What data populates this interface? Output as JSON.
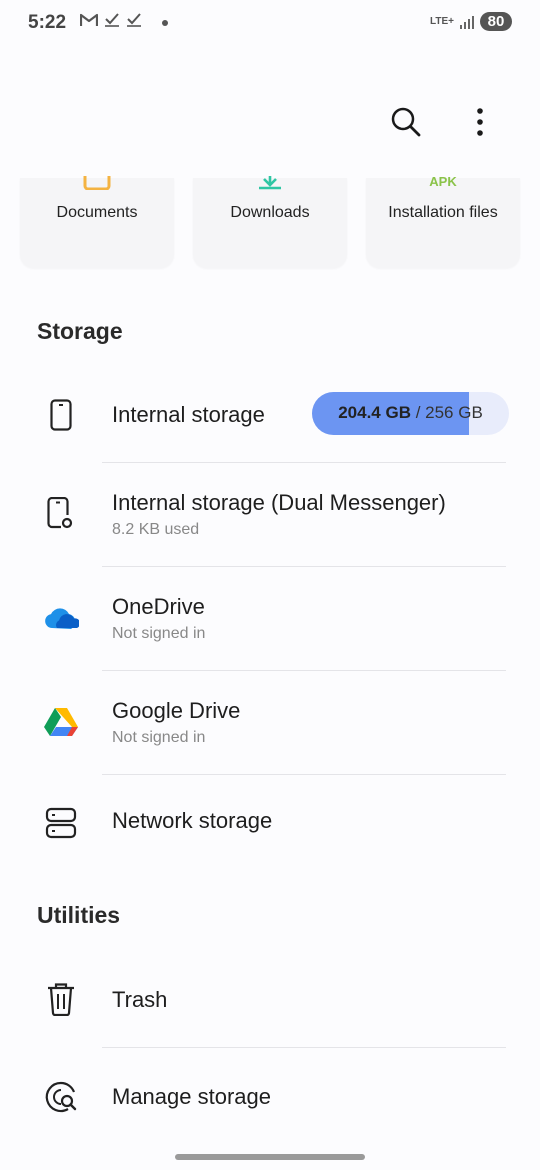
{
  "status_bar": {
    "time": "5:22",
    "lte": "LTE+",
    "battery": "80"
  },
  "categories": [
    {
      "label": "Documents",
      "icon": "documents-icon",
      "color": "#f4b342"
    },
    {
      "label": "Downloads",
      "icon": "download-icon",
      "color": "#2fc6a4"
    },
    {
      "label": "Installation files",
      "icon": "apk-icon",
      "icon_text": "APK",
      "color": "#8bc34a"
    }
  ],
  "storage_section": {
    "title": "Storage",
    "internal": {
      "title": "Internal storage",
      "used": "204.4 GB",
      "separator": " / ",
      "total": "256 GB",
      "used_fraction": 0.798
    },
    "dual": {
      "title": "Internal storage (Dual Messenger)",
      "subtitle": "8.2 KB used"
    },
    "onedrive": {
      "title": "OneDrive",
      "subtitle": "Not signed in"
    },
    "gdrive": {
      "title": "Google Drive",
      "subtitle": "Not signed in"
    },
    "network": {
      "title": "Network storage"
    }
  },
  "utilities_section": {
    "title": "Utilities",
    "trash": {
      "title": "Trash"
    },
    "manage": {
      "title": "Manage storage"
    }
  },
  "colors": {
    "accent": "#6c95f2",
    "pill_bg": "#e8ecfb"
  }
}
